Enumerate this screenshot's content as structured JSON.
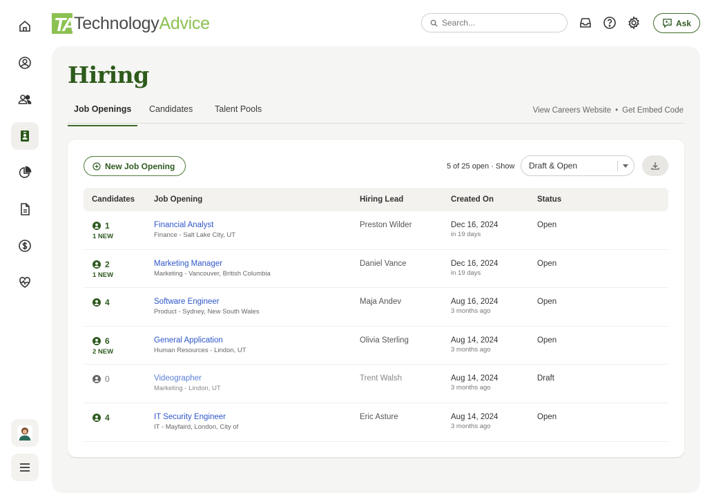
{
  "brand": {
    "mark": "TA",
    "name_main": "Technology",
    "name_accent": "Advice",
    "accent_color": "#8cc152"
  },
  "header": {
    "search_placeholder": "Search...",
    "icons": [
      "inbox-icon",
      "help-icon",
      "settings-icon"
    ],
    "ask_label": "Ask"
  },
  "sidebar": {
    "items": [
      {
        "name": "home",
        "icon": "home-icon"
      },
      {
        "name": "profile",
        "icon": "user-circle-icon"
      },
      {
        "name": "people",
        "icon": "people-icon"
      },
      {
        "name": "hiring",
        "icon": "id-badge-icon",
        "active": true
      },
      {
        "name": "reports",
        "icon": "pie-chart-icon"
      },
      {
        "name": "documents",
        "icon": "document-icon"
      },
      {
        "name": "payroll",
        "icon": "dollar-icon"
      },
      {
        "name": "benefits",
        "icon": "heart-pulse-icon"
      }
    ],
    "bottom": [
      {
        "name": "avatar",
        "icon": "avatar"
      },
      {
        "name": "menu",
        "icon": "hamburger-icon"
      }
    ]
  },
  "page": {
    "title": "Hiring",
    "tabs": [
      {
        "label": "Job Openings",
        "active": true
      },
      {
        "label": "Candidates",
        "active": false
      },
      {
        "label": "Talent Pools",
        "active": false
      }
    ],
    "links": {
      "careers": "View Careers Website",
      "separator": "•",
      "embed": "Get Embed Code"
    }
  },
  "toolbar": {
    "new_job_label": "New Job Opening",
    "count_text": "5 of 25 open · Show",
    "filter_value": "Draft & Open"
  },
  "table": {
    "columns": [
      "Candidates",
      "Job Opening",
      "Hiring Lead",
      "Created On",
      "Status"
    ],
    "rows": [
      {
        "candidates": "1",
        "new": "1 NEW",
        "title": "Financial Analyst",
        "sub": "Finance - Salt Lake City, UT",
        "lead": "Preston Wilder",
        "date": "Dec 16, 2024",
        "rel": "in 19 days",
        "status": "Open"
      },
      {
        "candidates": "2",
        "new": "1 NEW",
        "title": "Marketing Manager",
        "sub": "Marketing - Vancouver, British Columbia",
        "lead": "Daniel Vance",
        "date": "Dec 16, 2024",
        "rel": "in 19 days",
        "status": "Open"
      },
      {
        "candidates": "4",
        "new": "",
        "title": "Software Engineer",
        "sub": "Product - Sydney, New South Wales",
        "lead": "Maja Andev",
        "date": "Aug 16, 2024",
        "rel": "3 months ago",
        "status": "Open"
      },
      {
        "candidates": "6",
        "new": "2 NEW",
        "title": "General Application",
        "sub": "Human Resources - Lindon, UT",
        "lead": "Olivia Sterling",
        "date": "Aug 14, 2024",
        "rel": "3 months ago",
        "status": "Open"
      },
      {
        "candidates": "0",
        "new": "",
        "title": "Videographer",
        "sub": "Marketing - Lindon, UT",
        "lead": "Trent Walsh",
        "date": "Aug 14, 2024",
        "rel": "3 months ago",
        "status": "Draft"
      },
      {
        "candidates": "4",
        "new": "",
        "title": "IT Security Engineer",
        "sub": "IT - Mayfaird, London, City of",
        "lead": "Eric Asture",
        "date": "Aug 14, 2024",
        "rel": "3 months ago",
        "status": "Open"
      }
    ]
  }
}
